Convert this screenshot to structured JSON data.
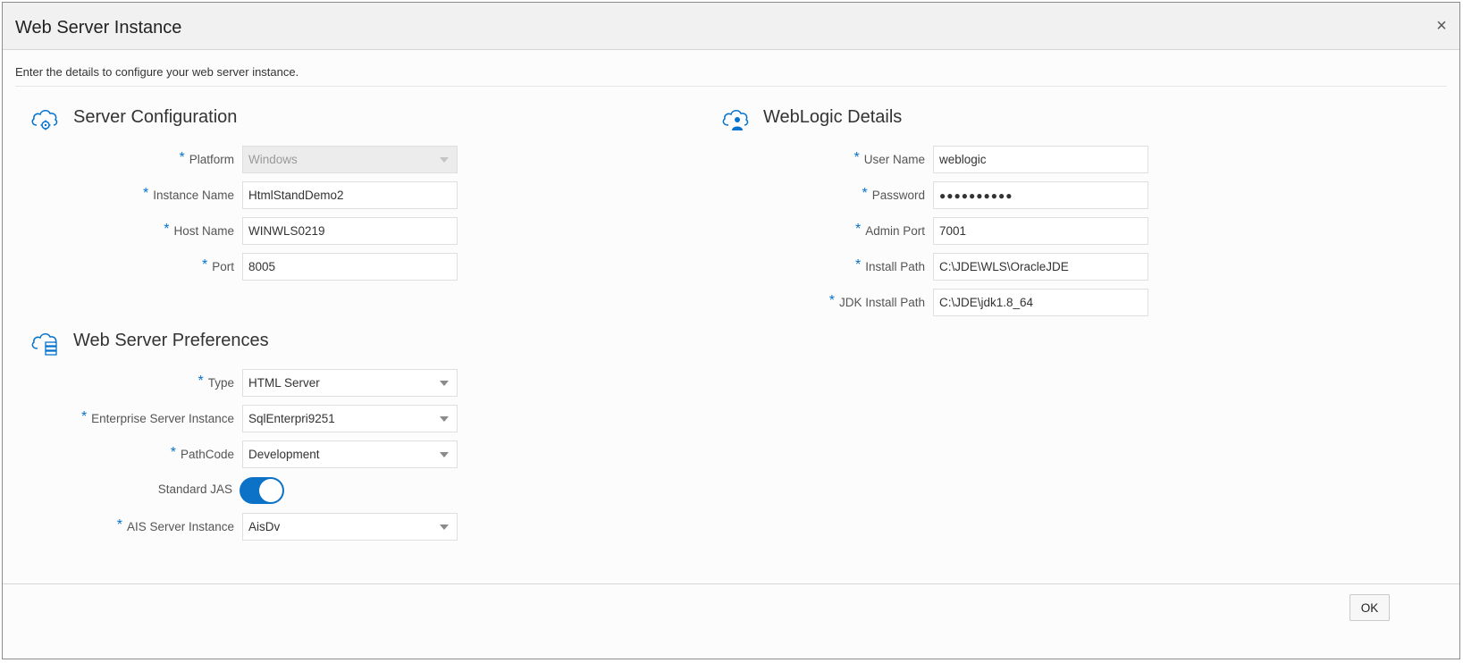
{
  "dialog": {
    "title": "Web Server Instance",
    "close_label": "×",
    "instructions": "Enter the details to configure your web server instance.",
    "ok_label": "OK"
  },
  "server_config": {
    "title": "Server Configuration",
    "icon": "cloud-gear-icon",
    "fields": {
      "platform": {
        "label": "Platform",
        "value": "Windows",
        "required": true,
        "disabled": true
      },
      "instance_name": {
        "label": "Instance Name",
        "value": "HtmlStandDemo2",
        "required": true
      },
      "host_name": {
        "label": "Host Name",
        "value": "WINWLS0219",
        "required": true
      },
      "port": {
        "label": "Port",
        "value": "8005",
        "required": true
      }
    }
  },
  "web_server_prefs": {
    "title": "Web Server Preferences",
    "icon": "cloud-server-icon",
    "fields": {
      "type": {
        "label": "Type",
        "value": "HTML Server",
        "required": true
      },
      "enterprise_server": {
        "label": "Enterprise Server Instance",
        "value": "SqlEnterpri9251",
        "required": true
      },
      "pathcode": {
        "label": "PathCode",
        "value": "Development",
        "required": true
      },
      "standard_jas": {
        "label": "Standard JAS",
        "on": true
      },
      "ais_server": {
        "label": "AIS Server Instance",
        "value": "AisDv",
        "required": true
      }
    }
  },
  "weblogic": {
    "title": "WebLogic Details",
    "icon": "cloud-user-icon",
    "fields": {
      "user_name": {
        "label": "User Name",
        "value": "weblogic",
        "required": true
      },
      "password": {
        "label": "Password",
        "value": "●●●●●●●●●●",
        "required": true
      },
      "admin_port": {
        "label": "Admin Port",
        "value": "7001",
        "required": true
      },
      "install_path": {
        "label": "Install Path",
        "value": "C:\\JDE\\WLS\\OracleJDE",
        "required": true
      },
      "jdk_install_path": {
        "label": "JDK Install Path",
        "value": "C:\\JDE\\jdk1.8_64",
        "required": true
      }
    }
  },
  "required_marker": "*",
  "colors": {
    "accent": "#0572ce",
    "toggle_on": "#0b72c7",
    "header_bg": "#f1f1f1",
    "dialog_bg": "#fcfcfc"
  }
}
